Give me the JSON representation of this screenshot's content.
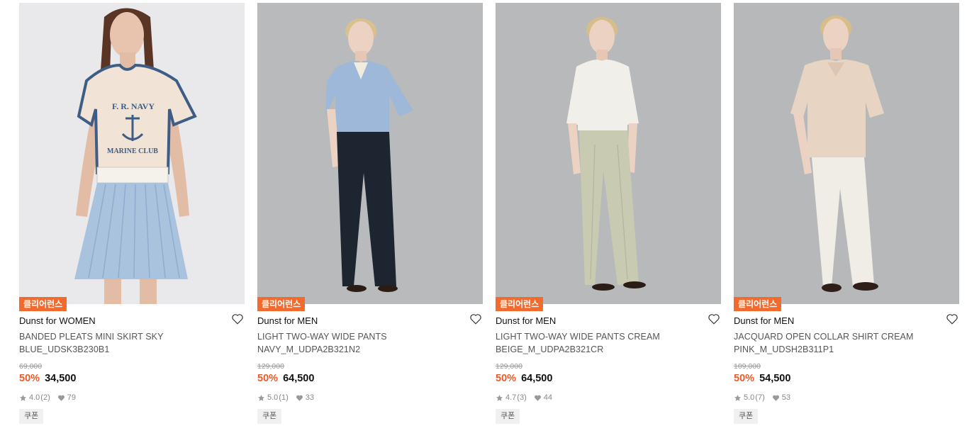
{
  "colors": {
    "accent": "#ee5a24",
    "badge_bg": "#f26a2e",
    "icon_gray": "#999999"
  },
  "products": [
    {
      "badge": "클리어런스",
      "brand": "Dunst for WOMEN",
      "name": "BANDED PLEATS MINI SKIRT SKY BLUE_UDSK3B230B1",
      "original_price": "69,000",
      "discount": "50%",
      "price": "34,500",
      "rating": "4.0",
      "reviews": "(2)",
      "likes": "79",
      "coupon": "쿠폰",
      "image_text": [
        "F. R. NAVY",
        "MARINE CLUB"
      ],
      "wish_icon": "heart-outline-icon"
    },
    {
      "badge": "클리어런스",
      "brand": "Dunst for MEN",
      "name": "LIGHT TWO-WAY WIDE PANTS NAVY_M_UDPA2B321N2",
      "original_price": "129,000",
      "discount": "50%",
      "price": "64,500",
      "rating": "5.0",
      "reviews": "(1)",
      "likes": "33",
      "coupon": "쿠폰",
      "wish_icon": "heart-outline-icon"
    },
    {
      "badge": "클리어런스",
      "brand": "Dunst for MEN",
      "name": "LIGHT TWO-WAY WIDE PANTS CREAM BEIGE_M_UDPA2B321CR",
      "original_price": "129,000",
      "discount": "50%",
      "price": "64,500",
      "rating": "4.7",
      "reviews": "(3)",
      "likes": "44",
      "coupon": "쿠폰",
      "wish_icon": "heart-outline-icon"
    },
    {
      "badge": "클리어런스",
      "brand": "Dunst for MEN",
      "name": "JACQUARD OPEN COLLAR SHIRT CREAM PINK_M_UDSH2B311P1",
      "original_price": "109,000",
      "discount": "50%",
      "price": "54,500",
      "rating": "5.0",
      "reviews": "(7)",
      "likes": "53",
      "coupon": "쿠폰",
      "wish_icon": "heart-outline-icon"
    }
  ]
}
